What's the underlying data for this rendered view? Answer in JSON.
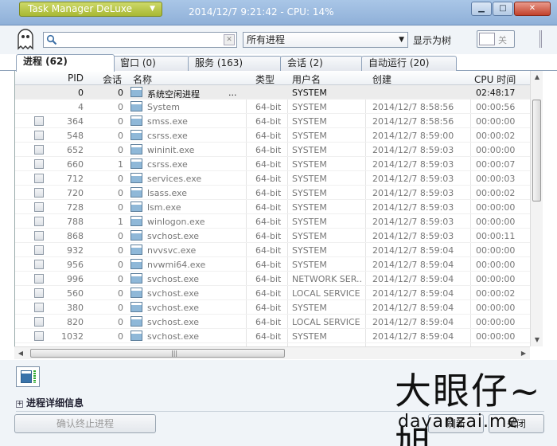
{
  "titlebar": {
    "app_menu": "Task Manager DeLuxe",
    "status": "2014/12/7 9:21:42 - CPU: 14%",
    "minimize": "▁",
    "maximize": "□",
    "close": "✕"
  },
  "toolbar": {
    "search_value": "",
    "filter_selected": "所有进程",
    "tree_label": "显示为树",
    "toggle_label": "关"
  },
  "tabs": [
    {
      "label": "进程 (62)",
      "active": true
    },
    {
      "label": "窗口 (0)",
      "active": false
    },
    {
      "label": "服务 (163)",
      "active": false
    },
    {
      "label": "会话 (2)",
      "active": false
    },
    {
      "label": "自动运行 (20)",
      "active": false
    }
  ],
  "table": {
    "headers": {
      "pid": "PID",
      "session": "会话",
      "name": "名称",
      "type": "类型",
      "user": "用户名",
      "created": "创建",
      "cpu": "CPU 时间"
    },
    "rows": [
      {
        "pid": "0",
        "session": "0",
        "name": "系统空闲进程",
        "dots": "...",
        "type": "",
        "user": "SYSTEM",
        "created": "",
        "cpu": "02:48:17",
        "check": false
      },
      {
        "pid": "4",
        "session": "0",
        "name": "System",
        "type": "64-bit",
        "user": "SYSTEM",
        "created": "2014/12/7 8:58:56",
        "cpu": "00:00:56",
        "check": false
      },
      {
        "pid": "364",
        "session": "0",
        "name": "smss.exe",
        "type": "64-bit",
        "user": "SYSTEM",
        "created": "2014/12/7 8:58:56",
        "cpu": "00:00:00",
        "check": true
      },
      {
        "pid": "548",
        "session": "0",
        "name": "csrss.exe",
        "type": "64-bit",
        "user": "SYSTEM",
        "created": "2014/12/7 8:59:00",
        "cpu": "00:00:02",
        "check": true
      },
      {
        "pid": "652",
        "session": "0",
        "name": "wininit.exe",
        "type": "64-bit",
        "user": "SYSTEM",
        "created": "2014/12/7 8:59:03",
        "cpu": "00:00:00",
        "check": true
      },
      {
        "pid": "660",
        "session": "1",
        "name": "csrss.exe",
        "type": "64-bit",
        "user": "SYSTEM",
        "created": "2014/12/7 8:59:03",
        "cpu": "00:00:07",
        "check": true
      },
      {
        "pid": "712",
        "session": "0",
        "name": "services.exe",
        "type": "64-bit",
        "user": "SYSTEM",
        "created": "2014/12/7 8:59:03",
        "cpu": "00:00:03",
        "check": true
      },
      {
        "pid": "720",
        "session": "0",
        "name": "lsass.exe",
        "type": "64-bit",
        "user": "SYSTEM",
        "created": "2014/12/7 8:59:03",
        "cpu": "00:00:02",
        "check": true
      },
      {
        "pid": "728",
        "session": "0",
        "name": "lsm.exe",
        "type": "64-bit",
        "user": "SYSTEM",
        "created": "2014/12/7 8:59:03",
        "cpu": "00:00:00",
        "check": true
      },
      {
        "pid": "788",
        "session": "1",
        "name": "winlogon.exe",
        "type": "64-bit",
        "user": "SYSTEM",
        "created": "2014/12/7 8:59:03",
        "cpu": "00:00:00",
        "check": true
      },
      {
        "pid": "868",
        "session": "0",
        "name": "svchost.exe",
        "type": "64-bit",
        "user": "SYSTEM",
        "created": "2014/12/7 8:59:03",
        "cpu": "00:00:11",
        "check": true
      },
      {
        "pid": "932",
        "session": "0",
        "name": "nvvsvc.exe",
        "type": "64-bit",
        "user": "SYSTEM",
        "created": "2014/12/7 8:59:04",
        "cpu": "00:00:00",
        "check": true
      },
      {
        "pid": "956",
        "session": "0",
        "name": "nvwmi64.exe",
        "type": "64-bit",
        "user": "SYSTEM",
        "created": "2014/12/7 8:59:04",
        "cpu": "00:00:00",
        "check": true
      },
      {
        "pid": "996",
        "session": "0",
        "name": "svchost.exe",
        "type": "64-bit",
        "user": "NETWORK SER...",
        "created": "2014/12/7 8:59:04",
        "cpu": "00:00:00",
        "check": true
      },
      {
        "pid": "560",
        "session": "0",
        "name": "svchost.exe",
        "type": "64-bit",
        "user": "LOCAL SERVICE",
        "created": "2014/12/7 8:59:04",
        "cpu": "00:00:02",
        "check": true
      },
      {
        "pid": "380",
        "session": "0",
        "name": "svchost.exe",
        "type": "64-bit",
        "user": "SYSTEM",
        "created": "2014/12/7 8:59:04",
        "cpu": "00:00:00",
        "check": true
      },
      {
        "pid": "820",
        "session": "0",
        "name": "svchost.exe",
        "type": "64-bit",
        "user": "LOCAL SERVICE",
        "created": "2014/12/7 8:59:04",
        "cpu": "00:00:00",
        "check": true
      },
      {
        "pid": "1032",
        "session": "0",
        "name": "svchost.exe",
        "type": "64-bit",
        "user": "SYSTEM",
        "created": "2014/12/7 8:59:04",
        "cpu": "00:00:00",
        "check": true
      }
    ]
  },
  "bottom": {
    "details_label": "进程详细信息",
    "kill_button": "确认终止进程",
    "refresh_button": "刷新",
    "close_button": "关闭"
  },
  "watermark": {
    "cn": "大眼仔~旭",
    "en": "dayanzai.me"
  }
}
